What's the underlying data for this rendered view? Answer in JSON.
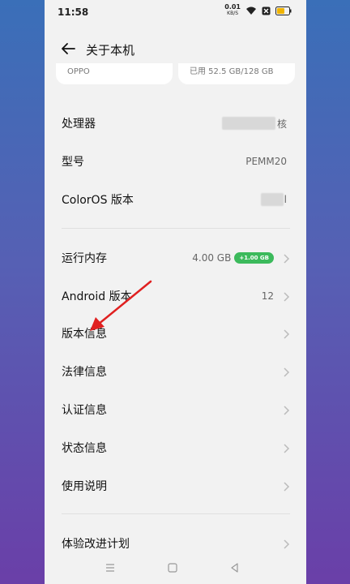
{
  "status_bar": {
    "time": "11:58",
    "net_speed": "0.01",
    "net_unit": "KB/S"
  },
  "header": {
    "title": "关于本机"
  },
  "storage_cards": {
    "left_text": "OPPO",
    "right_text": "已用 52.5 GB/128 GB"
  },
  "info_rows": [
    {
      "label": "处理器",
      "value_suffix": "核"
    },
    {
      "label": "型号",
      "value": "PEMM20"
    },
    {
      "label": "ColorOS 版本",
      "value_suffix": "l"
    }
  ],
  "memory_row": {
    "label": "运行内存",
    "value": "4.00 GB",
    "badge": "+1.00 GB"
  },
  "menu_rows": [
    {
      "label": "Android 版本",
      "value": "12"
    },
    {
      "label": "版本信息"
    },
    {
      "label": "法律信息"
    },
    {
      "label": "认证信息"
    },
    {
      "label": "状态信息"
    },
    {
      "label": "使用说明"
    }
  ],
  "bottom_row": {
    "label": "体验改进计划"
  },
  "colors": {
    "badge": "#3cba5c",
    "annotation_arrow": "#e02020",
    "background": "#f2f2f2"
  }
}
